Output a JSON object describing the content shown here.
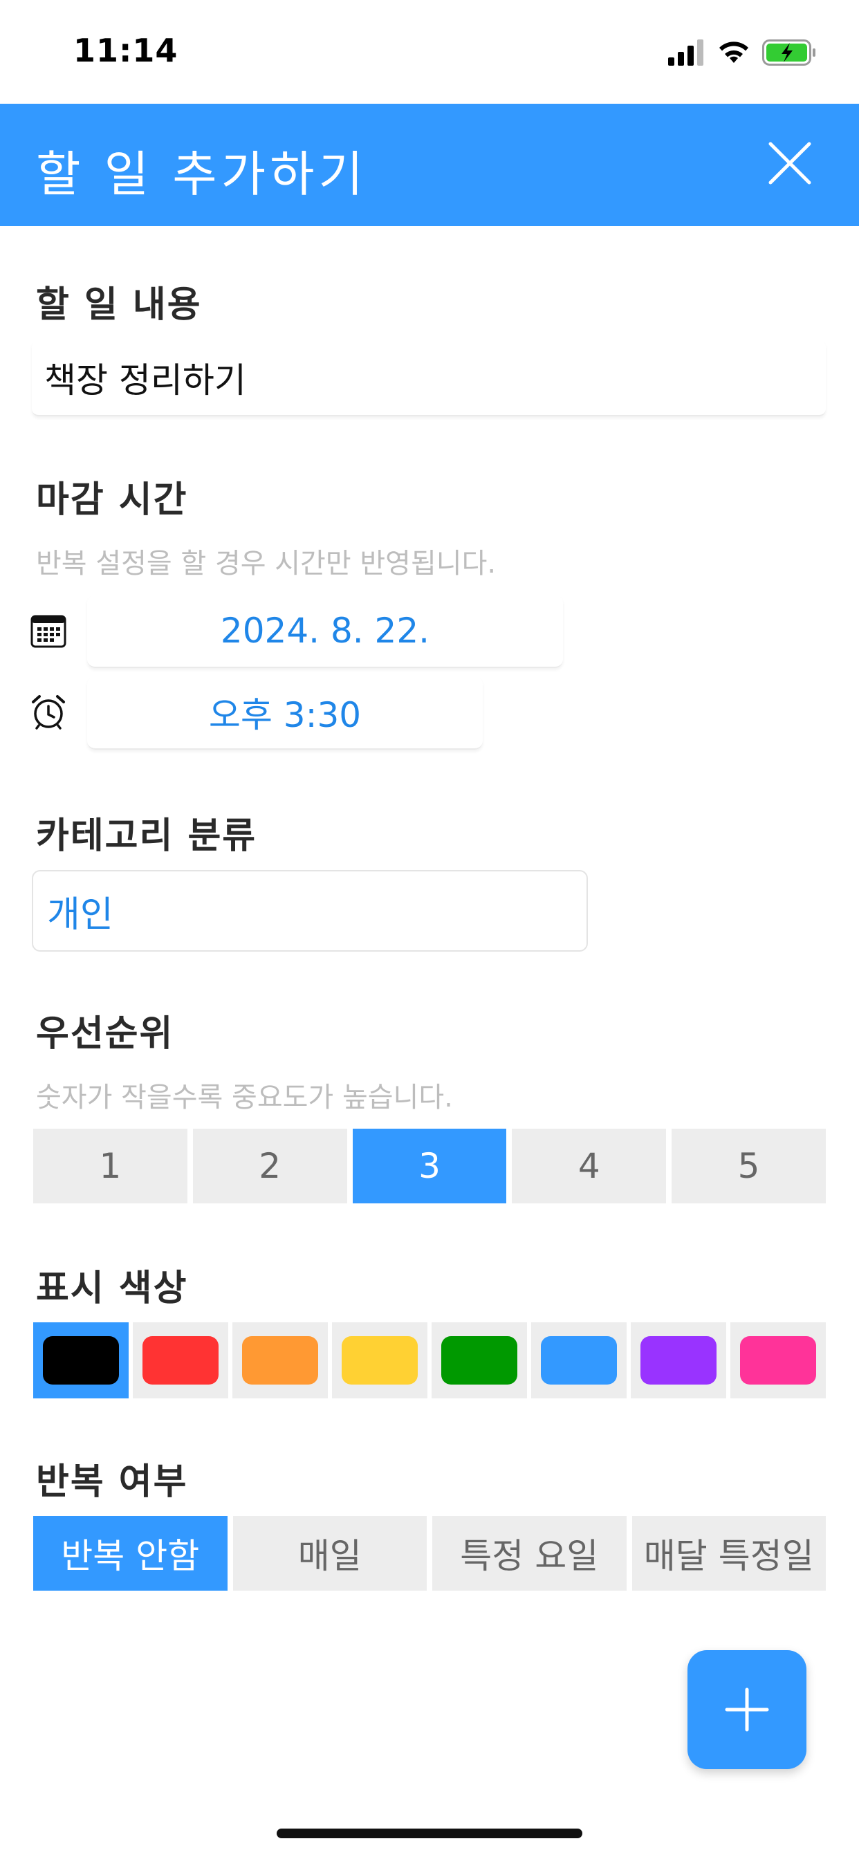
{
  "status_bar": {
    "time": "11:14"
  },
  "header": {
    "title": "할 일 추가하기"
  },
  "task": {
    "label": "할 일 내용",
    "value": "책장 정리하기"
  },
  "deadline": {
    "label": "마감 시간",
    "hint": "반복 설정을 할 경우 시간만 반영됩니다.",
    "date": "2024. 8. 22.",
    "time": "오후 3:30"
  },
  "category": {
    "label": "카테고리 분류",
    "selected": "개인"
  },
  "priority": {
    "label": "우선순위",
    "hint": "숫자가 작을수록 중요도가 높습니다.",
    "options": [
      "1",
      "2",
      "3",
      "4",
      "5"
    ],
    "selected_index": 2
  },
  "display_color": {
    "label": "표시 색상",
    "selected_index": 0,
    "colors": [
      "#000000",
      "#FF3333",
      "#FF9933",
      "#FFD133",
      "#009900",
      "#3399FF",
      "#9933FF",
      "#FF3399"
    ]
  },
  "repeat": {
    "label": "반복 여부",
    "options": [
      "반복 안함",
      "매일",
      "특정 요일",
      "매달 특정일"
    ],
    "selected_index": 0
  },
  "colors": {
    "accent": "#3399FF",
    "picker_text": "#1F86E8",
    "segment_bg": "#EDEDED"
  },
  "icons": {
    "close": "close-icon",
    "calendar": "calendar-icon",
    "alarm": "alarm-clock-icon",
    "add": "plus-icon"
  }
}
